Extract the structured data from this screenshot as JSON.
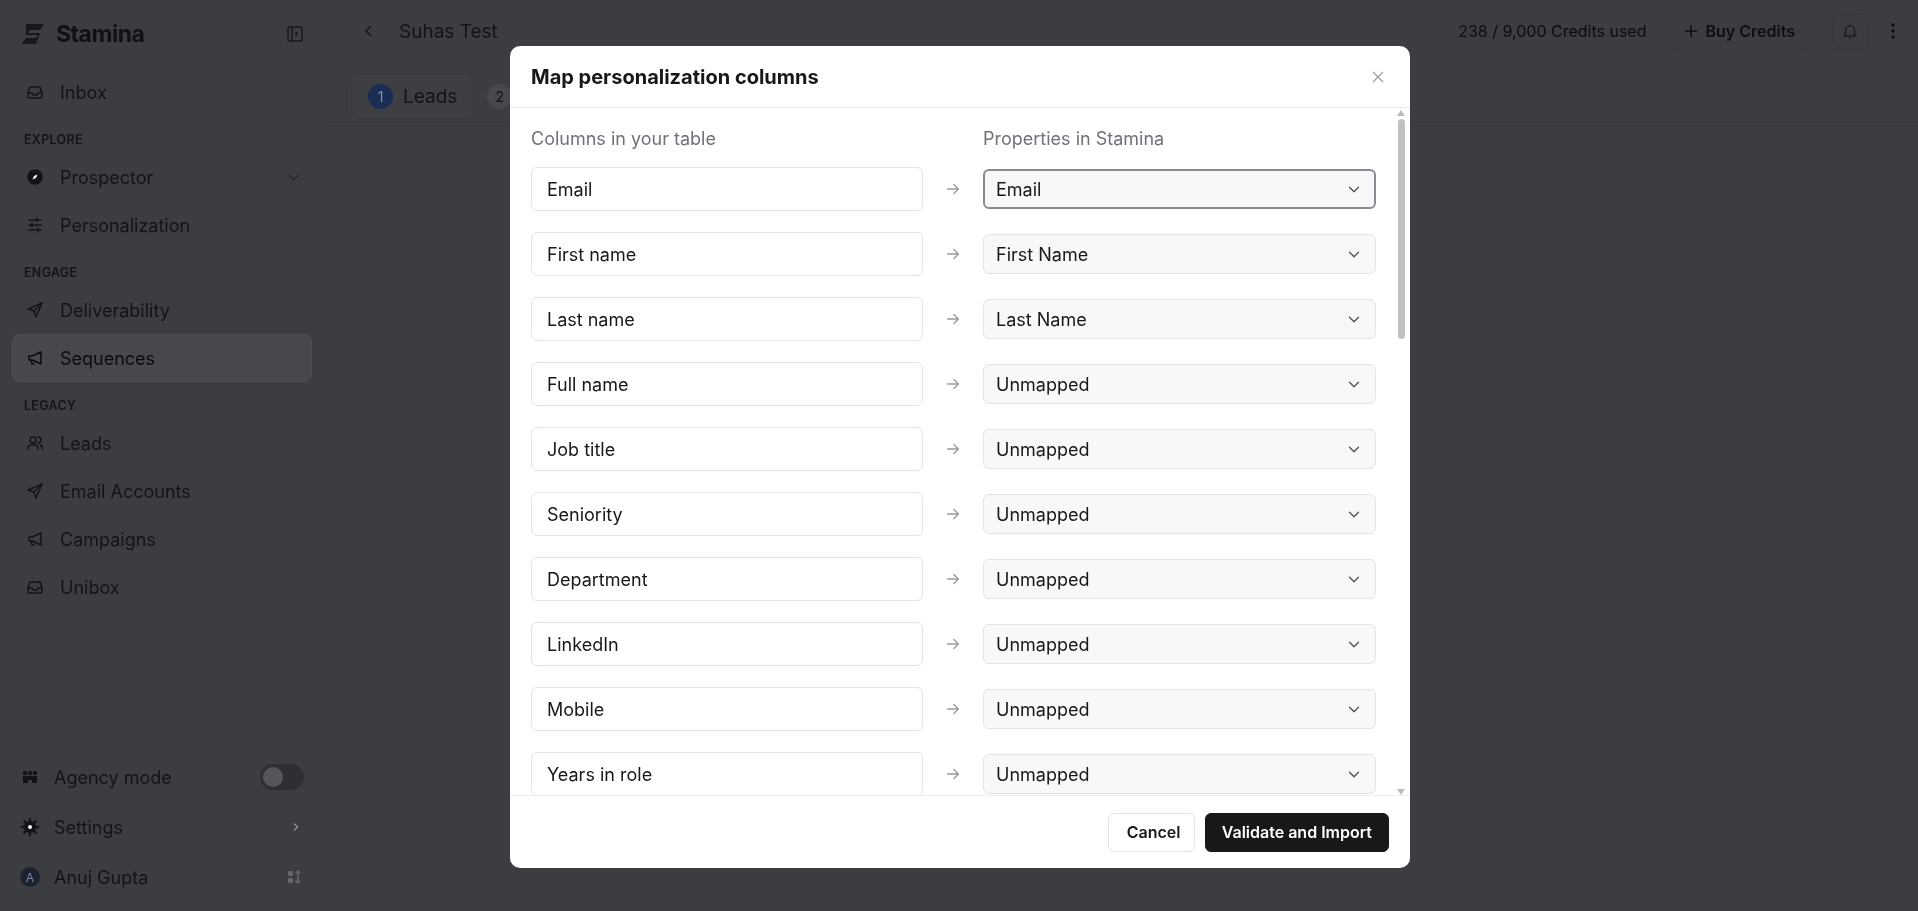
{
  "sidebar": {
    "brand": "Stamina",
    "top_items": [
      {
        "label": "Inbox",
        "expandable": false,
        "selected": false
      }
    ],
    "sections": [
      {
        "title": "EXPLORE",
        "items": [
          {
            "label": "Prospector",
            "expandable": true,
            "selected": false
          },
          {
            "label": "Personalization",
            "expandable": false,
            "selected": false
          }
        ]
      },
      {
        "title": "ENGAGE",
        "items": [
          {
            "label": "Deliverability",
            "expandable": false,
            "selected": false
          },
          {
            "label": "Sequences",
            "expandable": false,
            "selected": true
          }
        ]
      },
      {
        "title": "LEGACY",
        "items": [
          {
            "label": "Leads",
            "expandable": false,
            "selected": false
          },
          {
            "label": "Email Accounts",
            "expandable": false,
            "selected": false
          },
          {
            "label": "Campaigns",
            "expandable": false,
            "selected": false
          },
          {
            "label": "Unibox",
            "expandable": false,
            "selected": false
          }
        ]
      }
    ],
    "agency_mode": {
      "label": "Agency mode",
      "on": false
    },
    "settings": {
      "label": "Settings"
    },
    "user": {
      "initial": "A",
      "name": "Anuj Gupta"
    }
  },
  "header": {
    "title": "Suhas Test",
    "credits_used": "238",
    "credits_total": "/ 9,000 Credits used",
    "buy_button": "Buy Credits"
  },
  "steps": [
    {
      "number": "1",
      "label": "Leads",
      "selected": true
    },
    {
      "number": "2",
      "selected": false
    }
  ],
  "modal": {
    "title": "Map personalization columns",
    "left_heading": "Columns in your table",
    "right_heading": "Properties in Stamina",
    "rows": [
      {
        "column": "Email",
        "property": "Email",
        "focused": true
      },
      {
        "column": "First name",
        "property": "First Name",
        "focused": false
      },
      {
        "column": "Last name",
        "property": "Last Name",
        "focused": false
      },
      {
        "column": "Full name",
        "property": "Unmapped",
        "focused": false
      },
      {
        "column": "Job title",
        "property": "Unmapped",
        "focused": false
      },
      {
        "column": "Seniority",
        "property": "Unmapped",
        "focused": false
      },
      {
        "column": "Department",
        "property": "Unmapped",
        "focused": false
      },
      {
        "column": "LinkedIn",
        "property": "Unmapped",
        "focused": false
      },
      {
        "column": "Mobile",
        "property": "Unmapped",
        "focused": false
      },
      {
        "column": "Years in role",
        "property": "Unmapped",
        "focused": false
      }
    ],
    "buttons": {
      "cancel": "Cancel",
      "confirm": "Validate and Import"
    }
  }
}
